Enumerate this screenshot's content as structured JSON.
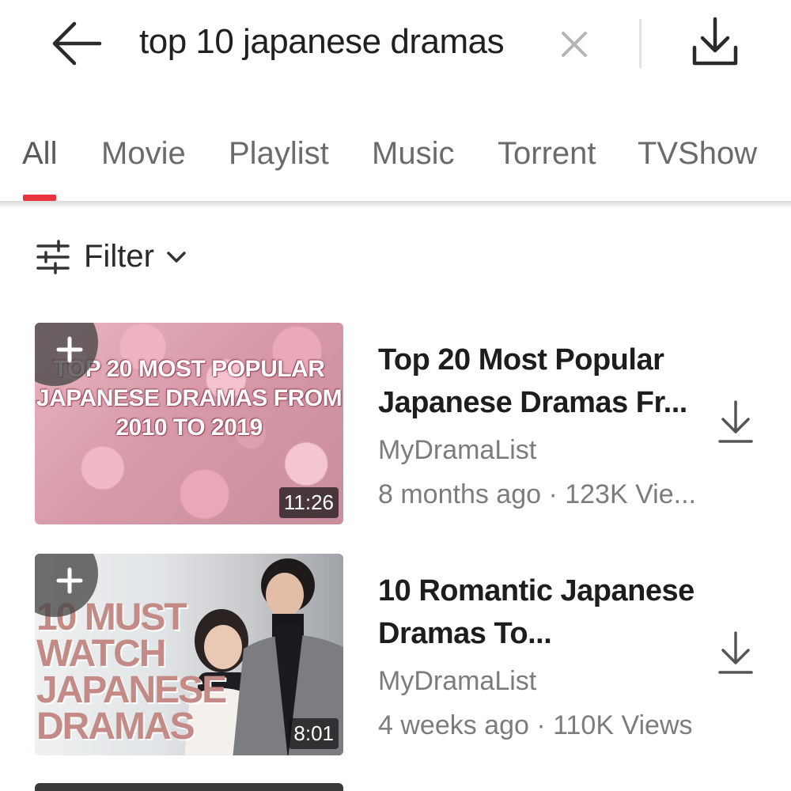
{
  "search": {
    "query": "top 10 japanese dramas",
    "back_icon": "arrow-left-icon",
    "clear_icon": "close-icon",
    "download_icon": "download-icon"
  },
  "tabs": [
    {
      "label": "All",
      "active": true
    },
    {
      "label": "Movie",
      "active": false
    },
    {
      "label": "Playlist",
      "active": false
    },
    {
      "label": "Music",
      "active": false
    },
    {
      "label": "Torrent",
      "active": false
    },
    {
      "label": "TVShow",
      "active": false
    }
  ],
  "colors": {
    "accent": "#e8343e",
    "tab_text": "#6b6b6b",
    "meta_text": "#7c7c7c"
  },
  "filter": {
    "label": "Filter",
    "icon": "sliders-icon"
  },
  "results": [
    {
      "title": "Top 20 Most Popular Japanese Dramas Fr...",
      "channel": "MyDramaList",
      "meta": "8 months ago · 123K Vie...",
      "duration": "11:26",
      "thumb_text": "TOP 20 MOST POPULAR JAPANESE DRAMAS FROM 2010 TO 2019"
    },
    {
      "title": "10 Romantic Japanese Dramas To...",
      "channel": "MyDramaList",
      "meta": "4 weeks ago · 110K Views",
      "duration": "8:01",
      "thumb_text": "10 MUST WATCH JAPANESE DRAMAS"
    }
  ]
}
